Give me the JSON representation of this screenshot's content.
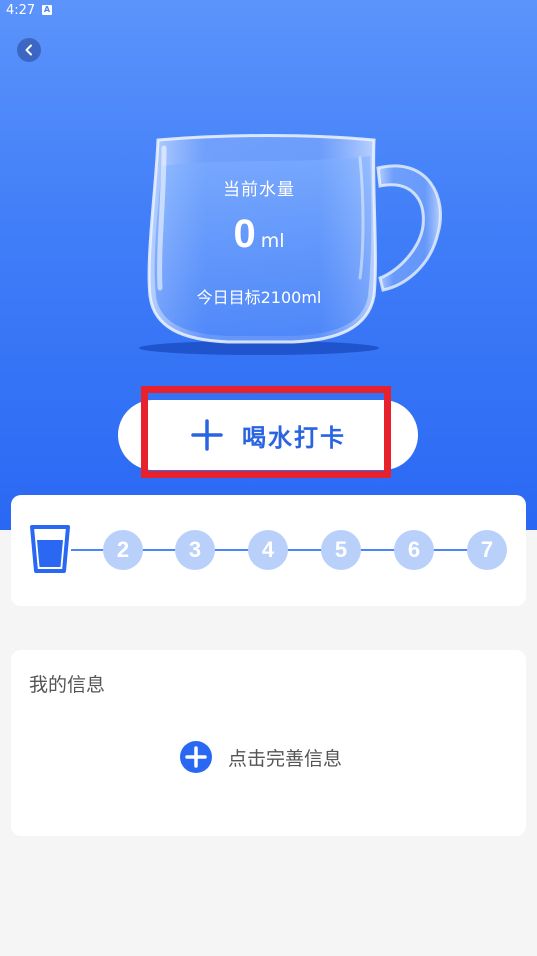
{
  "status_bar": {
    "time": "4:27",
    "notification_icon": "A"
  },
  "header": {
    "back_icon": "chevron-left-icon"
  },
  "cup": {
    "label": "当前水量",
    "amount": "0",
    "unit": "ml",
    "goal": "今日目标2100ml"
  },
  "checkin": {
    "label": "喝水打卡",
    "icon": "plus-icon"
  },
  "progress": {
    "days": [
      "2",
      "3",
      "4",
      "5",
      "6",
      "7"
    ],
    "current_icon": "water-glass-icon"
  },
  "info": {
    "title": "我的信息",
    "complete_label": "点击完善信息",
    "complete_icon": "plus-circle-icon"
  },
  "colors": {
    "primary": "#2a68f4",
    "accent": "#2a64e2",
    "inactive_dot": "#b9d0fb",
    "highlight": "#e8222c",
    "background": "#f5f5f5"
  }
}
